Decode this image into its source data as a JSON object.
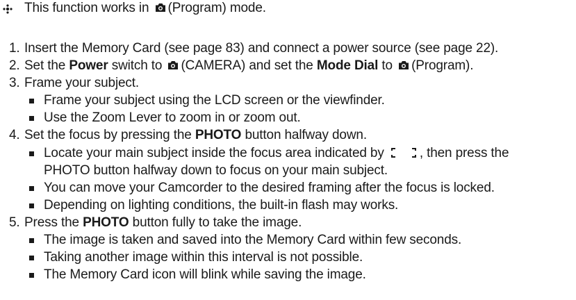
{
  "note": {
    "prefix": "This function works in",
    "suffix": "(Program) mode."
  },
  "steps": {
    "s1": {
      "num": "1.",
      "text": "Insert the Memory Card (see page 83) and connect a power source (see page 22)."
    },
    "s2": {
      "num": "2.",
      "pre": "Set the",
      "power_label": "Power",
      "mid1": "switch to",
      "camera_text": "(CAMERA) and set the",
      "mode_dial_label": "Mode Dial",
      "mid2": "to",
      "program_text": "(Program)."
    },
    "s3": {
      "num": "3.",
      "text": "Frame your subject.",
      "bullets": [
        "Frame your subject using the LCD screen or the viewfinder.",
        "Use the Zoom Lever to zoom in or zoom out."
      ]
    },
    "s4": {
      "num": "4.",
      "pre": "Set the focus by pressing the",
      "photo_label": "PHOTO",
      "post": "button halfway down.",
      "b1_pre": "Locate your main subject inside the focus area indicated by",
      "b1_post": ", then press the",
      "b1_cont": "PHOTO button halfway down to focus on your main subject.",
      "b2": "You can move your Camcorder to the desired framing after the focus is locked.",
      "b3": "Depending on lighting conditions, the built-in flash may works."
    },
    "s5": {
      "num": "5.",
      "pre": "Press the",
      "photo_label": "PHOTO",
      "post": "button fully to take the image.",
      "bullets": [
        "The image is taken and saved into the Memory Card within few seconds.",
        "Taking another image within this interval is not possible.",
        "The Memory Card icon will blink while saving the image."
      ]
    }
  },
  "icons": {
    "camera": "camera-icon",
    "focus_bracket": "focus-bracket-icon",
    "note_marker": "note-diamond-icon"
  },
  "colors": {
    "text": "#1a1a1a",
    "background": "#ffffff"
  }
}
